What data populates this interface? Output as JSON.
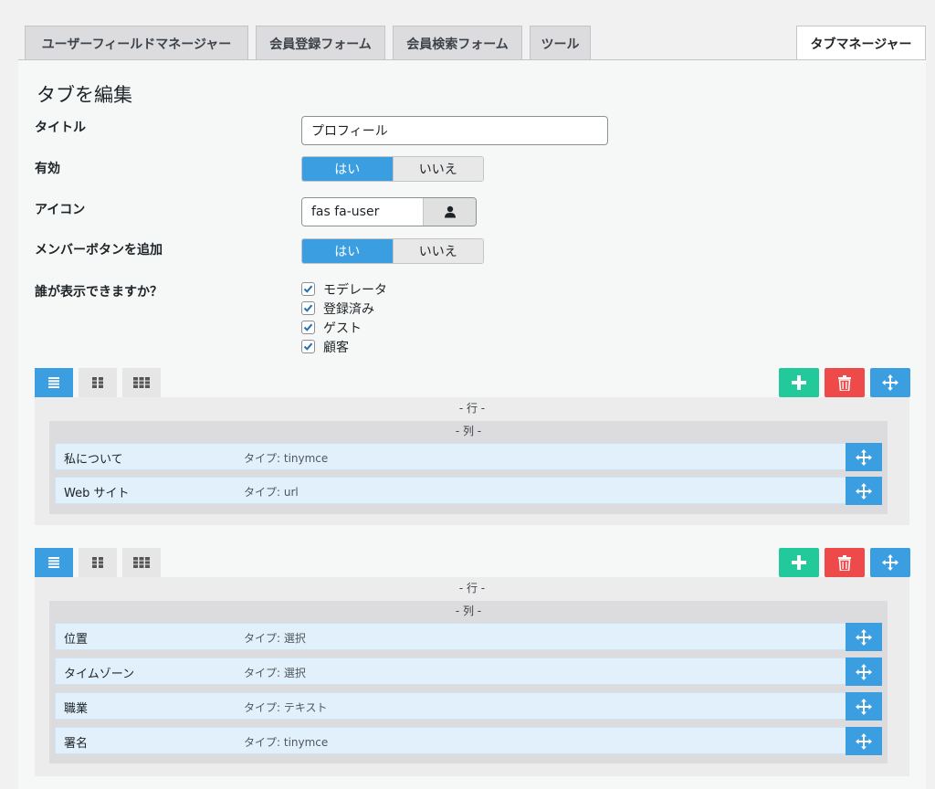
{
  "tabs": [
    {
      "label": "ユーザーフィールドマネージャー"
    },
    {
      "label": "会員登録フォーム"
    },
    {
      "label": "会員検索フォーム"
    },
    {
      "label": "ツール"
    },
    {
      "label": "タブマネージャー"
    }
  ],
  "editor": {
    "heading": "タブを編集",
    "title_label": "タイトル",
    "title_value": "プロフィール",
    "enabled_label": "有効",
    "icon_label": "アイコン",
    "icon_value": "fas fa-user",
    "member_button_label": "メンバーボタンを追加",
    "yes": "はい",
    "no": "いいえ",
    "visibility_label": "誰が表示できますか？",
    "visibility_options": [
      "モデレータ",
      "登録済み",
      "ゲスト",
      "顧客"
    ]
  },
  "rows": [
    {
      "row_label": "- 行 -",
      "col_label": "- 列 -",
      "fields": [
        {
          "name": "私について",
          "type": "タイプ: tinymce"
        },
        {
          "name": "Web サイト",
          "type": "タイプ: url"
        }
      ]
    },
    {
      "row_label": "- 行 -",
      "col_label": "- 列 -",
      "fields": [
        {
          "name": "位置",
          "type": "タイプ: 選択"
        },
        {
          "name": "タイムゾーン",
          "type": "タイプ: 選択"
        },
        {
          "name": "職業",
          "type": "タイプ: テキスト"
        },
        {
          "name": "署名",
          "type": "タイプ: tinymce"
        }
      ]
    }
  ],
  "colors": {
    "accent": "#3a9ee0",
    "add": "#22c99b",
    "delete": "#ef4a4a"
  }
}
